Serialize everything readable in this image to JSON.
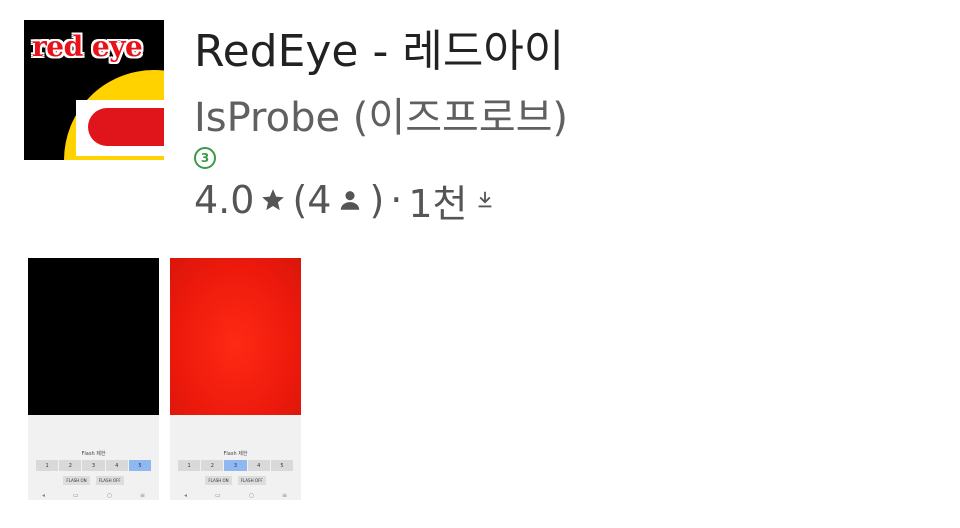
{
  "app": {
    "icon_text": "red eye",
    "title": "RedEye - 레드아이",
    "developer": "IsProbe (이즈프로브)",
    "age_rating": "3",
    "rating": "4.0",
    "review_open": "(4",
    "review_close": ")",
    "separator": "·",
    "installs": "1천",
    "icons": {
      "star": "star-icon",
      "person": "person-icon",
      "download": "download-icon"
    },
    "accent_color": "#3a9a4a"
  },
  "screenshots": [
    {
      "flash_label": "Flash 제한",
      "numbers": [
        "1",
        "2",
        "3",
        "4",
        "5"
      ],
      "selected_index": 4,
      "buttons": [
        "FLASH ON",
        "FLASH OFF"
      ]
    },
    {
      "flash_label": "Flash 제한",
      "numbers": [
        "1",
        "2",
        "3",
        "4",
        "5"
      ],
      "selected_index": 2,
      "buttons": [
        "FLASH ON",
        "FLASH OFF"
      ]
    }
  ]
}
